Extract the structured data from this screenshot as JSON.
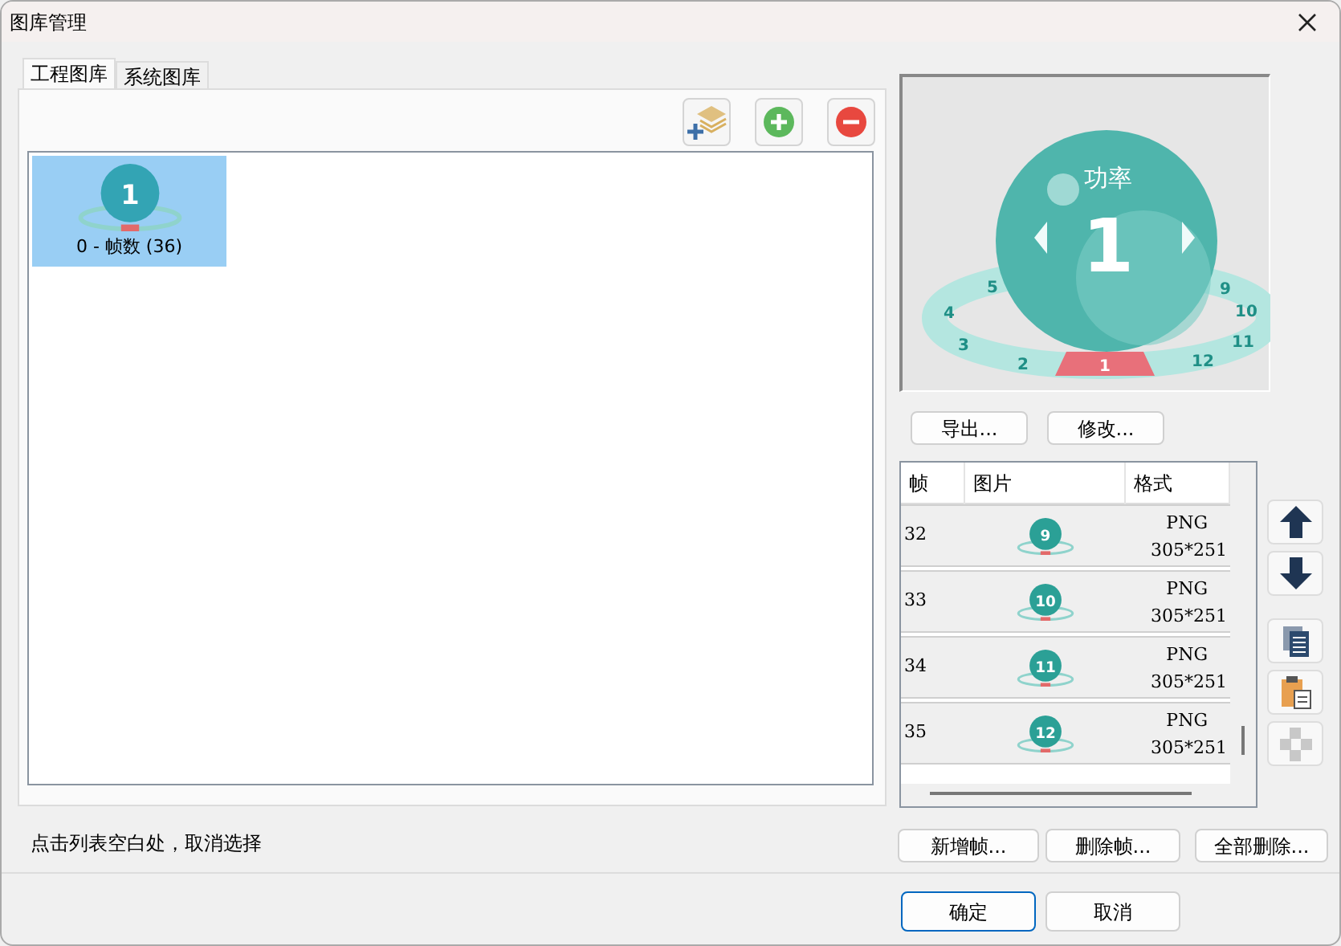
{
  "window": {
    "title": "图库管理"
  },
  "tabs": [
    {
      "label": "工程图库",
      "selected": true
    },
    {
      "label": "系统图库",
      "selected": false
    }
  ],
  "gallery": [
    {
      "label": "0 - 帧数 (36)",
      "thumb_number": "1",
      "selected": true
    }
  ],
  "hint": "点击列表空白处，取消选择",
  "preview": {
    "title": "功率",
    "value": "1",
    "segments": [
      {
        "label": "5",
        "selected": false
      },
      {
        "label": "4",
        "selected": false
      },
      {
        "label": "3",
        "selected": false
      },
      {
        "label": "2",
        "selected": false
      },
      {
        "label": "1",
        "selected": true
      },
      {
        "label": "12",
        "selected": false
      },
      {
        "label": "11",
        "selected": false
      },
      {
        "label": "10",
        "selected": false
      },
      {
        "label": "9",
        "selected": false
      }
    ]
  },
  "preview_buttons": [
    "导出...",
    "修改..."
  ],
  "frames": {
    "columns": [
      "帧",
      "图片",
      "格式"
    ],
    "rows": [
      {
        "frame": "32",
        "thumb_number": "9",
        "format": "PNG",
        "size": "305*251"
      },
      {
        "frame": "33",
        "thumb_number": "10",
        "format": "PNG",
        "size": "305*251"
      },
      {
        "frame": "34",
        "thumb_number": "11",
        "format": "PNG",
        "size": "305*251"
      },
      {
        "frame": "35",
        "thumb_number": "12",
        "format": "PNG",
        "size": "305*251"
      }
    ]
  },
  "frame_buttons": [
    "新增帧...",
    "删除帧...",
    "全部删除..."
  ],
  "dialog_buttons": [
    {
      "label": "确定",
      "default": true
    },
    {
      "label": "取消",
      "default": false
    }
  ]
}
